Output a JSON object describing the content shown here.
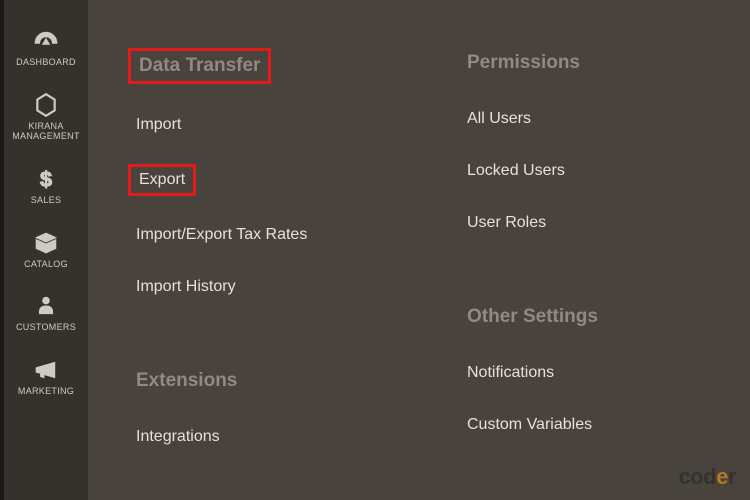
{
  "sidebar": {
    "items": [
      {
        "label": "DASHBOARD"
      },
      {
        "label": "KIRANA MANAGEMENT"
      },
      {
        "label": "SALES"
      },
      {
        "label": "CATALOG"
      },
      {
        "label": "CUSTOMERS"
      },
      {
        "label": "MARKETING"
      }
    ]
  },
  "panel": {
    "col1": {
      "section1": {
        "title": "Data Transfer",
        "items": [
          "Import",
          "Export",
          "Import/Export Tax Rates",
          "Import History"
        ]
      },
      "section2": {
        "title": "Extensions",
        "items": [
          "Integrations"
        ]
      }
    },
    "col2": {
      "section1": {
        "title": "Permissions",
        "items": [
          "All Users",
          "Locked Users",
          "User Roles"
        ]
      },
      "section2": {
        "title": "Other Settings",
        "items": [
          "Notifications",
          "Custom Variables"
        ]
      }
    }
  },
  "highlights": {
    "data_transfer_header": true,
    "export_item": true
  },
  "watermark": {
    "part1": "cod",
    "part2": "e",
    "part3": "r"
  },
  "colors": {
    "panel_bg": "#48433d",
    "sidebar_bg": "#35312c",
    "highlight": "#e11b1b",
    "header_text": "#8f8a82",
    "link_text": "#e6e1d9"
  }
}
